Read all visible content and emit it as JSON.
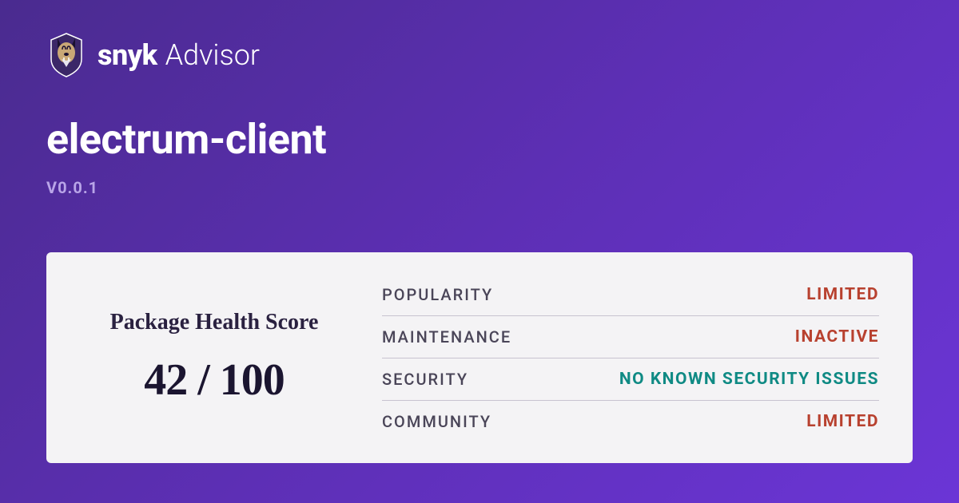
{
  "brand": {
    "name": "snyk",
    "product": "Advisor"
  },
  "package": {
    "name": "electrum-client",
    "version": "V0.0.1"
  },
  "score": {
    "label": "Package Health Score",
    "value": "42 / 100"
  },
  "metrics": [
    {
      "label": "POPULARITY",
      "value": "LIMITED",
      "status": "negative"
    },
    {
      "label": "MAINTENANCE",
      "value": "INACTIVE",
      "status": "negative"
    },
    {
      "label": "SECURITY",
      "value": "NO KNOWN SECURITY ISSUES",
      "status": "positive"
    },
    {
      "label": "COMMUNITY",
      "value": "LIMITED",
      "status": "negative"
    }
  ]
}
